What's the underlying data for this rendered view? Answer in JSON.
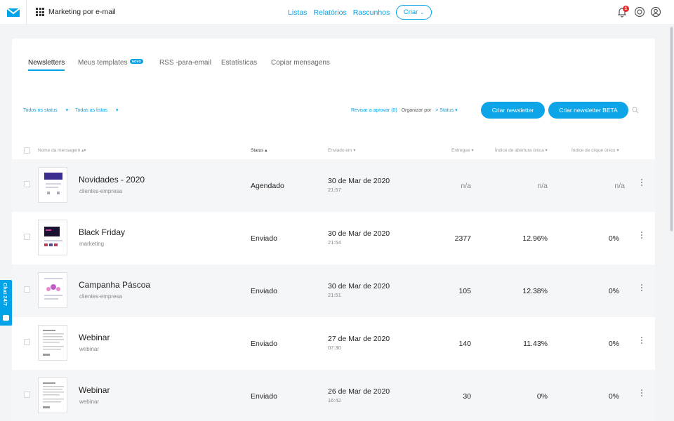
{
  "header": {
    "app_title": "Marketing por e-mail",
    "nav": [
      "Listas",
      "Relatórios",
      "Rascunhos"
    ],
    "create_label": "Criar",
    "notification_count": "1"
  },
  "chat": {
    "label": "Chat 24/7"
  },
  "tabs": [
    {
      "label": "Newsletters",
      "active": true
    },
    {
      "label": "Meus templates",
      "badge": "NOVO"
    },
    {
      "label": "RSS -para-email"
    },
    {
      "label": "Estatísticas"
    },
    {
      "label": "Copiar mensagens"
    }
  ],
  "filters": {
    "status": "Todos os status",
    "lists": "Todas as listas",
    "review": "Revisar a aprovar (0)",
    "sort_label": "Organizar por",
    "sort_value": "Status"
  },
  "buttons": {
    "create_newsletter": "Criar newsletter",
    "create_newsletter_beta": "Criar newsletter BETA"
  },
  "columns": {
    "name": "Nome da mensagem",
    "status": "Status",
    "sent": "Enviado em",
    "delivered": "Entregue",
    "open_rate": "Índice de abertura única",
    "click_rate": "Índice de clique único"
  },
  "rows": [
    {
      "name": "Novidades - 2020",
      "list": "clientes-empresa",
      "status": "Agendado",
      "date": "30 de Mar de 2020",
      "time": "21:57",
      "delivered": "n/a",
      "open": "n/a",
      "click": "n/a"
    },
    {
      "name": "Black Friday",
      "list": "marketing",
      "status": "Enviado",
      "date": "30 de Mar de 2020",
      "time": "21:54",
      "delivered": "2377",
      "open": "12.96%",
      "click": "0%"
    },
    {
      "name": "Campanha Páscoa",
      "list": "clientes-empresa",
      "status": "Enviado",
      "date": "30 de Mar de 2020",
      "time": "21:51",
      "delivered": "105",
      "open": "12.38%",
      "click": "0%"
    },
    {
      "name": "Webinar",
      "list": "webinar",
      "status": "Enviado",
      "date": "27 de Mar de 2020",
      "time": "07:30",
      "delivered": "140",
      "open": "11.43%",
      "click": "0%"
    },
    {
      "name": "Webinar",
      "list": "webinar",
      "status": "Enviado",
      "date": "26 de Mar de 2020",
      "time": "16:42",
      "delivered": "30",
      "open": "0%",
      "click": "0%"
    }
  ],
  "colors": {
    "accent": "#00a2e8",
    "badge_red": "#e52b2b"
  }
}
